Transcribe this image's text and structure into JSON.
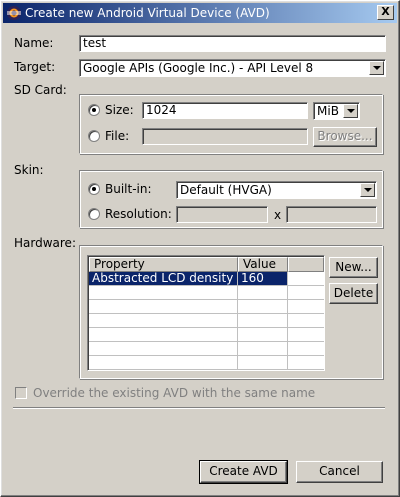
{
  "window": {
    "title": "Create new Android Virtual Device (AVD)",
    "close_glyph": "X"
  },
  "form": {
    "name_label": "Name:",
    "name_value": "test",
    "target_label": "Target:",
    "target_value": "Google APIs (Google Inc.) - API Level 8",
    "sdcard_label": "SD Card:",
    "sdcard_size_label": "Size:",
    "sdcard_size_value": "1024",
    "sdcard_unit": "MiB",
    "sdcard_file_label": "File:",
    "sdcard_file_value": "",
    "browse_label": "Browse...",
    "skin_label": "Skin:",
    "skin_builtin_label": "Built-in:",
    "skin_builtin_value": "Default (HVGA)",
    "skin_resolution_label": "Resolution:",
    "skin_resolution_separator": "x",
    "hardware_label": "Hardware:",
    "hardware_columns": [
      "Property",
      "Value"
    ],
    "hardware_rows": [
      {
        "property": "Abstracted LCD density",
        "value": "160"
      }
    ],
    "new_button": "New...",
    "delete_button": "Delete",
    "override_label": "Override the existing AVD with the same name"
  },
  "footer": {
    "create_button": "Create AVD",
    "cancel_button": "Cancel"
  }
}
